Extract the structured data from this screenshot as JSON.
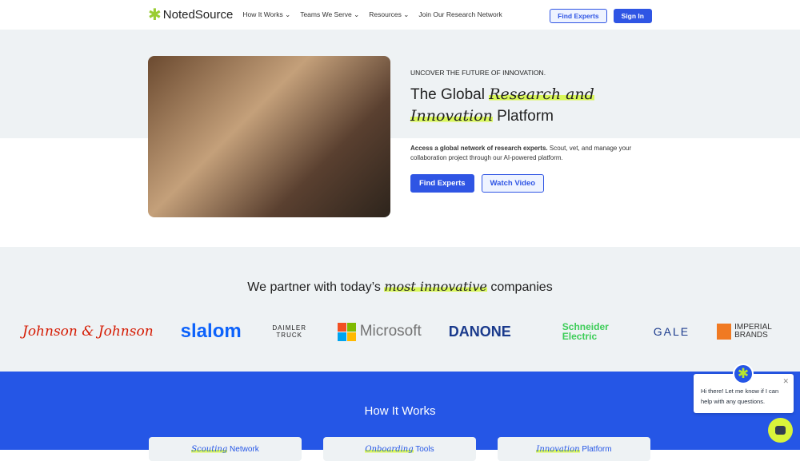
{
  "nav": {
    "logo": "NotedSource",
    "menu": [
      "How It Works",
      "Teams We Serve",
      "Resources",
      "Join Our Research Network"
    ],
    "find_experts": "Find Experts",
    "sign_in": "Sign In"
  },
  "hero": {
    "eyebrow": "UNCOVER THE FUTURE OF INNOVATION.",
    "title_a": "The Global ",
    "title_hl1": "Research and",
    "title_hl2": "Innovation",
    "title_b": " Platform",
    "desc_bold": "Access a global network of research experts.",
    "desc": " Scout, vet, and manage your collaboration project through our AI-powered platform.",
    "find_experts": "Find Experts",
    "watch_video": "Watch Video"
  },
  "partners": {
    "title_a": "We partner with today’s ",
    "title_hl": "most innovative",
    "title_b": " companies",
    "logos": [
      "Johnson & Johnson",
      "slalom",
      "DAIMLER TRUCK",
      "Microsoft",
      "DANONE",
      "Schneider Electric",
      "GALE",
      "IMPERIAL BRANDS"
    ]
  },
  "how": {
    "title": "How It Works",
    "cards": [
      {
        "hl": "Scouting",
        "rest": " Network"
      },
      {
        "hl": "Onboarding",
        "rest": " Tools"
      },
      {
        "hl": "Innovation",
        "rest": " Platform"
      }
    ]
  },
  "chat": {
    "message": "Hi there! Let me know if I can help with any questions."
  },
  "colors": {
    "accent": "#2556e6",
    "highlight": "#d9f75a"
  }
}
